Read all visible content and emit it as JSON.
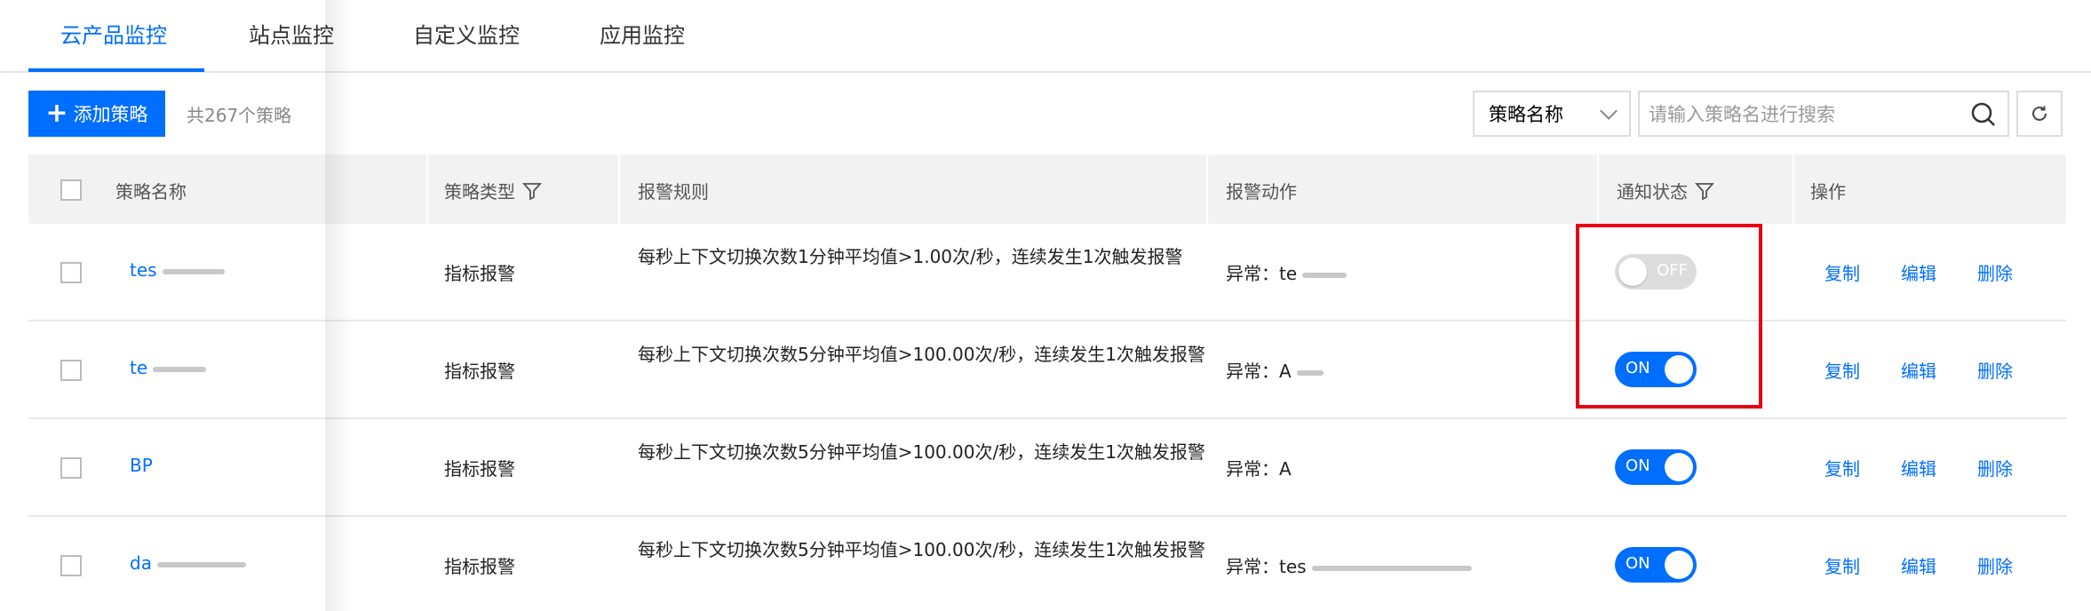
{
  "tabs": [
    {
      "label": "云产品监控",
      "active": true
    },
    {
      "label": "站点监控",
      "active": false
    },
    {
      "label": "自定义监控",
      "active": false
    },
    {
      "label": "应用监控",
      "active": false
    }
  ],
  "toolbar": {
    "add_label": "添加策略",
    "count_text": "共267个策略",
    "select_value": "策略名称",
    "search_placeholder": "请输入策略名进行搜索"
  },
  "table": {
    "headers": {
      "name": "策略名称",
      "type": "策略类型",
      "rule": "报警规则",
      "action": "报警动作",
      "notify": "通知状态",
      "ops": "操作"
    },
    "rows": [
      {
        "name": "tes",
        "type": "指标报警",
        "rule": "每秒上下文切换次数1分钟平均值>1.00次/秒，连续发生1次触发报警",
        "action": "异常：te",
        "toggle": "OFF",
        "ops": [
          "复制",
          "编辑",
          "删除"
        ]
      },
      {
        "name": "te",
        "type": "指标报警",
        "rule": "每秒上下文切换次数5分钟平均值>100.00次/秒，连续发生1次触发报警",
        "action": "异常：A",
        "toggle": "ON",
        "ops": [
          "复制",
          "编辑",
          "删除"
        ]
      },
      {
        "name": "BP",
        "type": "指标报警",
        "rule": "每秒上下文切换次数5分钟平均值>100.00次/秒，连续发生1次触发报警",
        "action": "异常：A",
        "toggle": "ON",
        "ops": [
          "复制",
          "编辑",
          "删除"
        ]
      },
      {
        "name": "da",
        "type": "指标报警",
        "rule": "每秒上下文切换次数5分钟平均值>100.00次/秒，连续发生1次触发报警",
        "action": "异常：tes",
        "toggle": "ON",
        "ops": [
          "复制",
          "编辑",
          "删除"
        ]
      }
    ]
  },
  "colors": {
    "accent": "#006eff",
    "highlight": "#e60012",
    "toggle_off": "#dcdcdc"
  }
}
